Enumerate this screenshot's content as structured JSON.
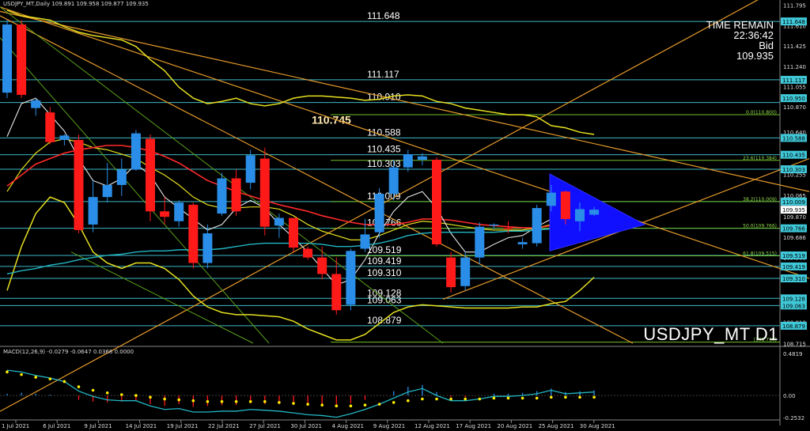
{
  "window": {
    "header": "USDJPY_MT,Daily  109.891 109.958 109.877 109.935",
    "symbol_timeframe": "USDJPY_MT D1"
  },
  "info_panel": {
    "time_remain_label": "TIME REMAIN",
    "time_remain": "22:36:42",
    "bid_label": "Bid",
    "bid": "109.935"
  },
  "macd_header": "MACD(12,26,9) -0.0279 -0.0647 0.0368 0.0000",
  "price_axis_labels": [
    "111.795",
    "111.610",
    "111.425",
    "111.240",
    "111.055",
    "110.870",
    "110.640",
    "110.455",
    "110.255",
    "110.065",
    "109.870",
    "109.686",
    "109.500",
    "109.310",
    "109.128",
    "108.910",
    "108.715"
  ],
  "price_tags": [
    {
      "text": "111.648",
      "v": 111.648
    },
    {
      "text": "111.117",
      "v": 111.117
    },
    {
      "text": "110.950",
      "v": 110.95
    },
    {
      "text": "110.588",
      "v": 110.588
    },
    {
      "text": "110.435",
      "v": 110.435
    },
    {
      "text": "110.303",
      "v": 110.303
    },
    {
      "text": "110.009",
      "v": 110.009
    },
    {
      "text": "109.935",
      "v": 109.935
    },
    {
      "text": "109.766",
      "v": 109.766
    },
    {
      "text": "109.519",
      "v": 109.519
    },
    {
      "text": "109.419",
      "v": 109.419
    },
    {
      "text": "109.310",
      "v": 109.31
    },
    {
      "text": "109.128",
      "v": 109.128
    },
    {
      "text": "109.063",
      "v": 109.063
    },
    {
      "text": "108.879",
      "v": 108.879
    }
  ],
  "levels": [
    {
      "text": "111.648",
      "v": 111.648
    },
    {
      "text": "111.117",
      "v": 111.117
    },
    {
      "text": "110.910",
      "v": 110.91
    },
    {
      "text": "110.588",
      "v": 110.588
    },
    {
      "text": "110.435",
      "v": 110.435
    },
    {
      "text": "110.303",
      "v": 110.303
    },
    {
      "text": "110.009",
      "v": 110.009
    },
    {
      "text": "109.766",
      "v": 109.766
    },
    {
      "text": "109.519",
      "v": 109.519
    },
    {
      "text": "109.419",
      "v": 109.419
    },
    {
      "text": "109.310",
      "v": 109.31
    },
    {
      "text": "109.128",
      "v": 109.128
    },
    {
      "text": "109.063",
      "v": 109.063
    },
    {
      "text": "108.879",
      "v": 108.879
    }
  ],
  "label_110745": "110.745",
  "fib_labels": [
    {
      "text": "0.0(110.800)",
      "v": 110.8
    },
    {
      "text": "23.6(110.384)",
      "v": 110.384
    },
    {
      "text": "38.2(110.009)",
      "v": 110.009
    },
    {
      "text": "50.0(109.766)",
      "v": 109.766
    },
    {
      "text": "61.8(109.515)",
      "v": 109.515
    },
    {
      "text": "(108.730)",
      "v": 108.73
    }
  ],
  "macd_axis_labels": [
    "0.4819",
    "0.00",
    "-0.2532"
  ],
  "date_labels": [
    "1 Jul 2021",
    "6 Jul 2021",
    "9 Jul 2021",
    "14 Jul 2021",
    "19 Jul 2021",
    "22 Jul 2021",
    "27 Jul 2021",
    "30 Jul 2021",
    "4 Aug 2021",
    "9 Aug 2021",
    "12 Aug 2021",
    "17 Aug 2021",
    "20 Aug 2021",
    "25 Aug 2021",
    "30 Aug 2021"
  ],
  "chart_data": {
    "type": "candlestick",
    "symbol": "USDJPY_MT",
    "timeframe": "D1",
    "candles": [
      {
        "o": 111.0,
        "h": 111.66,
        "l": 110.95,
        "c": 111.62
      },
      {
        "o": 111.62,
        "h": 111.66,
        "l": 110.95,
        "c": 110.98
      },
      {
        "o": 110.86,
        "h": 110.95,
        "l": 110.79,
        "c": 110.93
      },
      {
        "o": 110.82,
        "h": 110.87,
        "l": 110.53,
        "c": 110.55
      },
      {
        "o": 110.57,
        "h": 110.62,
        "l": 110.52,
        "c": 110.61
      },
      {
        "o": 110.57,
        "h": 110.62,
        "l": 109.72,
        "c": 109.75
      },
      {
        "o": 109.8,
        "h": 110.2,
        "l": 109.73,
        "c": 110.05
      },
      {
        "o": 110.05,
        "h": 110.36,
        "l": 110.0,
        "c": 110.16
      },
      {
        "o": 110.16,
        "h": 110.4,
        "l": 110.06,
        "c": 110.3
      },
      {
        "o": 110.3,
        "h": 110.66,
        "l": 110.29,
        "c": 110.63
      },
      {
        "o": 110.58,
        "h": 110.62,
        "l": 109.83,
        "c": 109.92
      },
      {
        "o": 109.92,
        "h": 110.05,
        "l": 109.8,
        "c": 109.87
      },
      {
        "o": 109.83,
        "h": 110.02,
        "l": 109.78,
        "c": 110.0
      },
      {
        "o": 109.98,
        "h": 110.0,
        "l": 109.4,
        "c": 109.45
      },
      {
        "o": 109.45,
        "h": 109.8,
        "l": 109.4,
        "c": 109.72
      },
      {
        "o": 109.9,
        "h": 110.27,
        "l": 109.88,
        "c": 110.22
      },
      {
        "o": 110.22,
        "h": 110.3,
        "l": 109.88,
        "c": 109.92
      },
      {
        "o": 110.18,
        "h": 110.48,
        "l": 110.12,
        "c": 110.43
      },
      {
        "o": 110.4,
        "h": 110.5,
        "l": 109.7,
        "c": 109.78
      },
      {
        "o": 109.79,
        "h": 109.9,
        "l": 109.68,
        "c": 109.86
      },
      {
        "o": 109.86,
        "h": 109.86,
        "l": 109.55,
        "c": 109.59
      },
      {
        "o": 109.58,
        "h": 109.6,
        "l": 109.48,
        "c": 109.5
      },
      {
        "o": 109.5,
        "h": 109.6,
        "l": 109.3,
        "c": 109.35
      },
      {
        "o": 109.35,
        "h": 109.5,
        "l": 108.98,
        "c": 109.02
      },
      {
        "o": 109.07,
        "h": 109.58,
        "l": 109.02,
        "c": 109.56
      },
      {
        "o": 109.58,
        "h": 109.85,
        "l": 109.55,
        "c": 109.71
      },
      {
        "o": 109.73,
        "h": 110.13,
        "l": 109.68,
        "c": 110.08
      },
      {
        "o": 110.08,
        "h": 110.39,
        "l": 110.02,
        "c": 110.32
      },
      {
        "o": 110.32,
        "h": 110.48,
        "l": 110.28,
        "c": 110.44
      },
      {
        "o": 110.39,
        "h": 110.45,
        "l": 110.34,
        "c": 110.42
      },
      {
        "o": 110.39,
        "h": 110.41,
        "l": 109.6,
        "c": 109.62
      },
      {
        "o": 109.5,
        "h": 109.55,
        "l": 109.18,
        "c": 109.23
      },
      {
        "o": 109.24,
        "h": 109.55,
        "l": 109.2,
        "c": 109.5
      },
      {
        "o": 109.5,
        "h": 109.82,
        "l": 109.44,
        "c": 109.78
      },
      {
        "o": 109.79,
        "h": 109.81,
        "l": 109.76,
        "c": 109.8
      },
      {
        "o": 109.77,
        "h": 109.83,
        "l": 109.72,
        "c": 109.76
      },
      {
        "o": 109.62,
        "h": 109.68,
        "l": 109.58,
        "c": 109.64
      },
      {
        "o": 109.63,
        "h": 109.98,
        "l": 109.6,
        "c": 109.95
      },
      {
        "o": 109.97,
        "h": 110.16,
        "l": 109.92,
        "c": 110.09
      },
      {
        "o": 110.1,
        "h": 110.11,
        "l": 109.8,
        "c": 109.85
      },
      {
        "o": 109.83,
        "h": 110.0,
        "l": 109.74,
        "c": 109.94
      },
      {
        "o": 109.89,
        "h": 109.96,
        "l": 109.88,
        "c": 109.935
      }
    ],
    "macd_histogram": [
      0.02,
      0.03,
      0.02,
      0.01,
      0.0,
      -0.05,
      -0.07,
      -0.08,
      -0.07,
      -0.06,
      -0.1,
      -0.12,
      -0.1,
      -0.13,
      -0.12,
      -0.11,
      -0.11,
      -0.09,
      -0.1,
      -0.1,
      -0.11,
      -0.12,
      -0.12,
      -0.13,
      -0.09,
      -0.05,
      0.0,
      0.05,
      0.1,
      0.12,
      0.04,
      -0.02,
      -0.02,
      0.0,
      0.02,
      0.02,
      0.03,
      0.05,
      0.08,
      0.04,
      0.05,
      0.06
    ],
    "macd_signal": [
      0.27,
      0.24,
      0.21,
      0.19,
      0.16,
      0.1,
      0.06,
      0.03,
      0.01,
      0.0,
      -0.02,
      -0.04,
      -0.05,
      -0.06,
      -0.07,
      -0.07,
      -0.07,
      -0.07,
      -0.07,
      -0.08,
      -0.09,
      -0.1,
      -0.11,
      -0.12,
      -0.12,
      -0.11,
      -0.1,
      -0.08,
      -0.06,
      -0.04,
      -0.04,
      -0.04,
      -0.04,
      -0.04,
      -0.03,
      -0.03,
      -0.03,
      -0.03,
      -0.02,
      -0.02,
      -0.02,
      -0.02
    ],
    "ylim": [
      108.72,
      111.8
    ],
    "macd_ylim": [
      -0.2532,
      0.4819
    ],
    "legend": "top-left"
  }
}
